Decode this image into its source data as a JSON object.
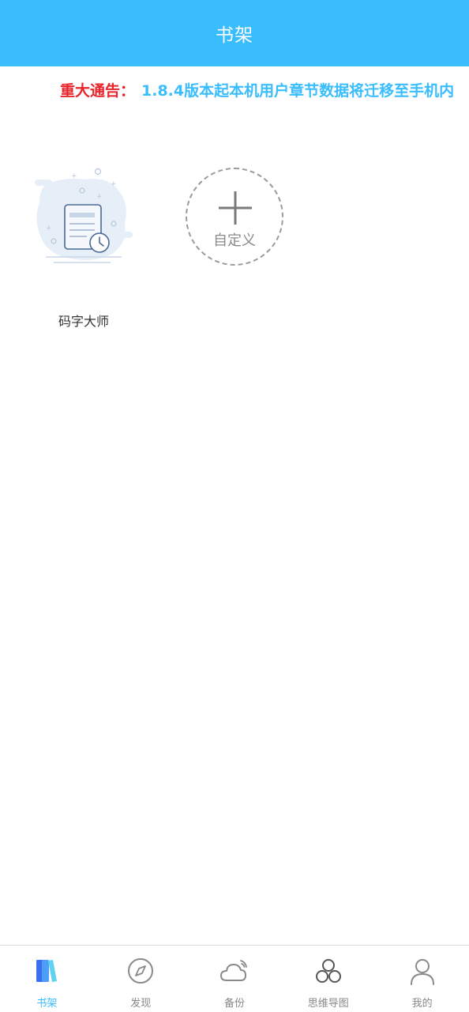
{
  "header": {
    "title": "书架"
  },
  "notice": {
    "label": "重大通告：",
    "text": "1.8.4版本起本机用户章节数据将迁移至手机内"
  },
  "bookshelf": {
    "books": [
      {
        "title": "码字大师",
        "cover_icon": "document-clock-icon"
      }
    ],
    "add_item": {
      "label": "自定义",
      "icon": "plus-icon"
    }
  },
  "tabbar": {
    "active_color": "#3ABDFC",
    "items": [
      {
        "label": "书架",
        "icon": "bookshelf-icon",
        "active": true
      },
      {
        "label": "发现",
        "icon": "compass-icon",
        "active": false
      },
      {
        "label": "备份",
        "icon": "cloud-icon",
        "active": false
      },
      {
        "label": "思维导图",
        "icon": "mindmap-icon",
        "active": false
      },
      {
        "label": "我的",
        "icon": "user-icon",
        "active": false
      }
    ]
  },
  "colors": {
    "header_bg": "#3ABDFC",
    "notice_label": "#E8242A",
    "notice_text": "#3ABDFC"
  }
}
